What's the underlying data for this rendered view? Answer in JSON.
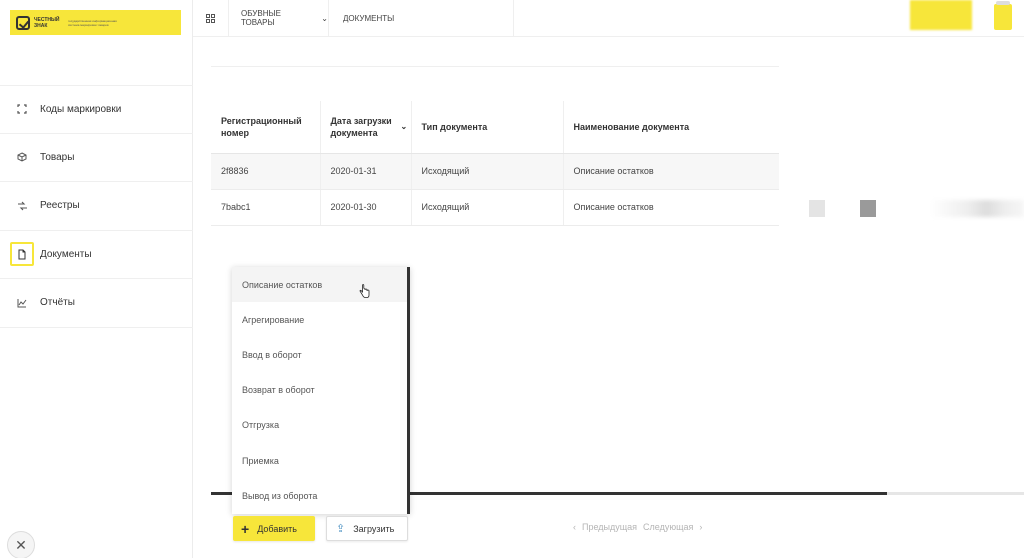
{
  "topbar": {
    "product_group": "ОБУВНЫЕ ТОВАРЫ",
    "section": "ДОКУМЕНТЫ"
  },
  "logo": {
    "name": "ЧЕСТНЫЙ ЗНАК",
    "tagline": "государственная информационная система маркировки товаров"
  },
  "sidebar": {
    "items": [
      {
        "label": "Коды маркировки",
        "icon": "codes-icon",
        "active": false
      },
      {
        "label": "Товары",
        "icon": "box-icon",
        "active": false
      },
      {
        "label": "Реестры",
        "icon": "registry-icon",
        "active": false
      },
      {
        "label": "Документы",
        "icon": "document-icon",
        "active": true
      },
      {
        "label": "Отчёты",
        "icon": "chart-icon",
        "active": false
      }
    ]
  },
  "table": {
    "columns": [
      "Регистрационный номер",
      "Дата загрузки документа",
      "Тип документа",
      "Наименование документа"
    ],
    "rows": [
      {
        "reg_number": "2f8836",
        "date": "2020-01-31",
        "type": "Исходящий",
        "name": "Описание остатков"
      },
      {
        "reg_number": "7babc1",
        "date": "2020-01-30",
        "type": "Исходящий",
        "name": "Описание остатков"
      }
    ]
  },
  "dropdown": {
    "items": [
      "Описание остатков",
      "Агрегирование",
      "Ввод в оборот",
      "Возврат в оборот",
      "Отгрузка",
      "Приемка",
      "Вывод из оборота"
    ]
  },
  "actions": {
    "add_label": "Добавить",
    "upload_label": "Загрузить"
  },
  "pager": {
    "prev_label": "Предыдущая",
    "next_label": "Следующая"
  },
  "colors": {
    "accent": "#f7e63a",
    "text": "#333333"
  }
}
